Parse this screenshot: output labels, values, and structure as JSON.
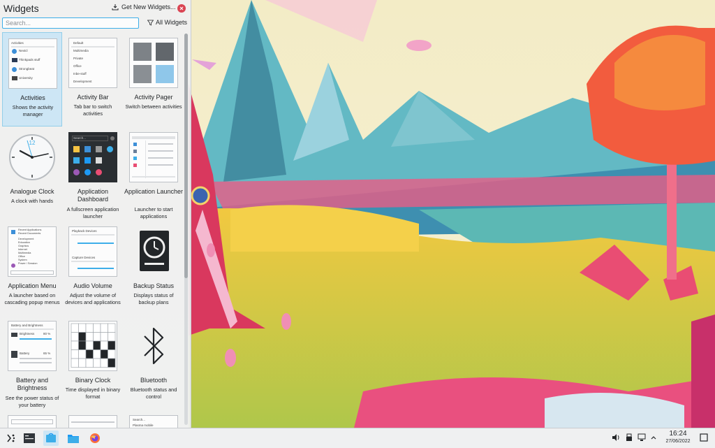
{
  "panel": {
    "title": "Widgets",
    "get_new_label": "Get New Widgets...",
    "search_placeholder": "Search...",
    "filter_label": "All Widgets"
  },
  "widgets": [
    {
      "title": "Activities",
      "desc": "Shows the activity manager",
      "thumb_icon": "activities-preview"
    },
    {
      "title": "Activity Bar",
      "desc": "Tab bar to switch activities",
      "thumb_icon": "activity-bar-preview"
    },
    {
      "title": "Activity Pager",
      "desc": "Switch between activities",
      "thumb_icon": "activity-pager-preview"
    },
    {
      "title": "Analogue Clock",
      "desc": "A clock with hands",
      "thumb_icon": "clock-icon"
    },
    {
      "title": "Application Dashboard",
      "desc": "A fullscreen application launcher",
      "thumb_icon": "dashboard-preview"
    },
    {
      "title": "Application Launcher",
      "desc": "Launcher to start applications",
      "thumb_icon": "launcher-preview"
    },
    {
      "title": "Application Menu",
      "desc": "A launcher based on cascading popup menus",
      "thumb_icon": "app-menu-preview"
    },
    {
      "title": "Audio Volume",
      "desc": "Adjust the volume of devices and applications",
      "thumb_icon": "audio-preview"
    },
    {
      "title": "Backup Status",
      "desc": "Displays status of backup plans",
      "thumb_icon": "backup-drive-icon"
    },
    {
      "title": "Battery and Brightness",
      "desc": "See the power status of your battery",
      "thumb_icon": "battery-preview"
    },
    {
      "title": "Binary Clock",
      "desc": "Time displayed in binary format",
      "thumb_icon": "binary-clock-preview"
    },
    {
      "title": "Bluetooth",
      "desc": "Bluetooth status and control",
      "thumb_icon": "bluetooth-icon"
    }
  ],
  "previews": {
    "activities_header": "Activities",
    "activities_items": [
      "Nextcl",
      "Thinkpads stuff",
      "Strongbeat",
      "University"
    ],
    "activity_bar_items": [
      "Default",
      "Multimedia",
      "Private",
      "Office",
      "Inbe-stuff",
      "Development"
    ],
    "dashboard_search": "Search...",
    "clock_label": "12",
    "audio_playback": "Playback Devices",
    "audio_capture": "Capture Devices",
    "battery_header": "Battery and Brightness",
    "battery_rows": [
      {
        "label": "Brightness",
        "value": "80 %"
      },
      {
        "label": "Battery",
        "value": "65 %"
      }
    ],
    "menu_items": [
      "Recent Applications",
      "Recent Documents",
      "Development",
      "Education",
      "Graphics",
      "Internet",
      "Multimedia",
      "Office",
      "System",
      "Power / Session"
    ],
    "partial_search": "Search...",
    "partial_label": "Plasma mobile"
  },
  "taskbar": {
    "time": "16:24",
    "date": "27/06/2022",
    "apps": [
      "application-launcher-icon",
      "terminal-icon",
      "discover-icon",
      "file-manager-icon",
      "firefox-icon"
    ]
  },
  "colors": {
    "accent": "#3daee9",
    "selection": "#cde6f5",
    "close": "#da4453",
    "panel_bg": "#eff0f1"
  }
}
